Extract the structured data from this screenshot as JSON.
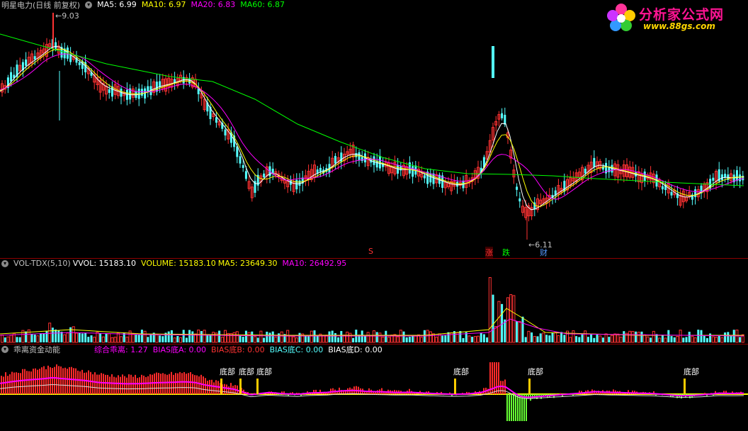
{
  "main": {
    "stock_title": "明星电力(日线 前复权)",
    "ma5": "MA5: 6.99",
    "ma10": "MA10: 6.97",
    "ma20": "MA20: 6.83",
    "ma60": "MA60: 6.87",
    "high_label": "9.03",
    "low_label": "6.11",
    "markers": {
      "s": "S",
      "zhang": "涨",
      "die": "跌",
      "cai": "财"
    }
  },
  "volume": {
    "name": "VOL-TDX(5,10)",
    "vvol": "VVOL: 15183.10",
    "volume": "VOLUME: 15183.10",
    "ma5": "MA5: 23649.30",
    "ma10": "MA10: 26492.95"
  },
  "indicator": {
    "name": "乖离资金动能",
    "composite": "综合乖离: 1.27",
    "bias_a": "BIAS底A: 0.00",
    "bias_b": "BIAS底B: 0.00",
    "bias_c": "BIAS底C: 0.00",
    "bias_d": "BIAS底D: 0.00",
    "bottom_label": "底部"
  },
  "logo": {
    "main": "分析家公式网",
    "sub": "www.88gs.com"
  },
  "colors": {
    "up": "#ff3232",
    "down": "#54ffff",
    "ma5": "#ffffff",
    "ma10": "#ffff00",
    "ma20": "#ff00ff",
    "ma60": "#00ff00",
    "border": "#8b0000"
  },
  "chart_data": {
    "type": "candlestick",
    "price_range": [
      6.11,
      9.03
    ],
    "indicator_summary": {
      "composite_bias": 1.27,
      "bias_a": 0.0,
      "bias_b": 0.0,
      "bias_c": 0.0,
      "bias_d": 0.0
    },
    "volume_summary": {
      "vvol": 15183.1,
      "volume": 15183.1,
      "ma5": 23649.3,
      "ma10": 26492.95
    }
  }
}
